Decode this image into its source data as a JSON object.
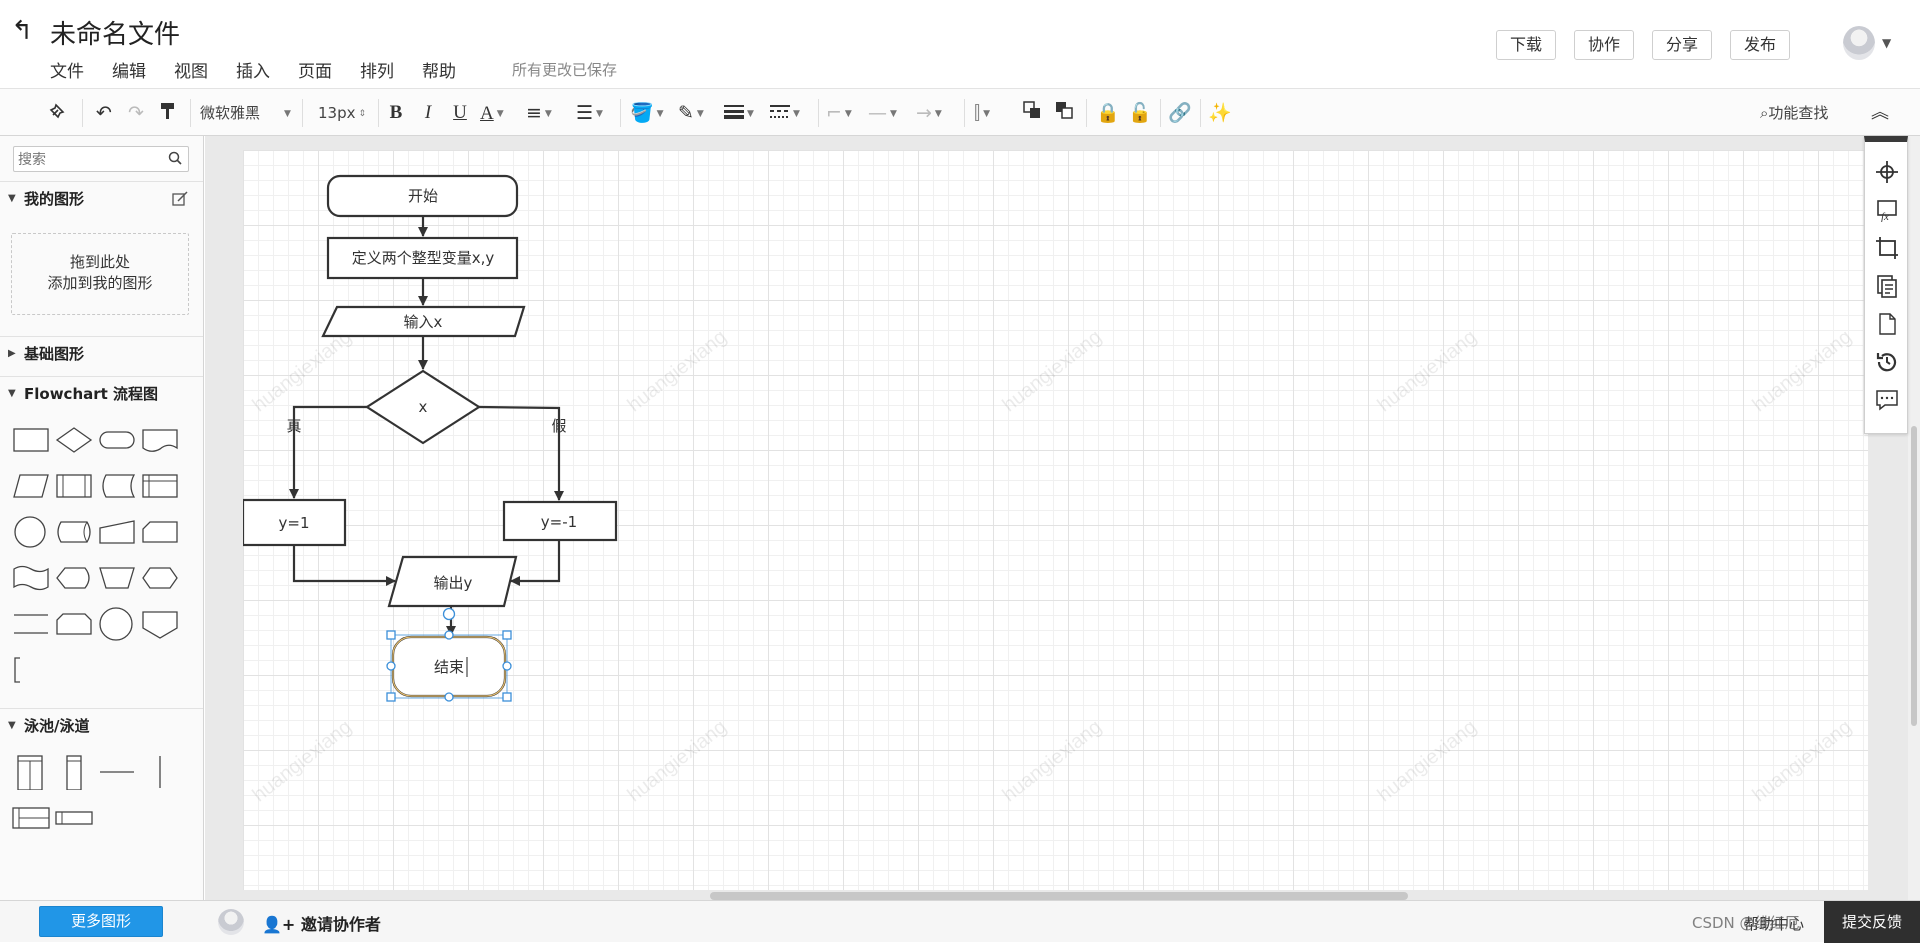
{
  "header": {
    "back_icon": "back-arrow-icon",
    "title": "未命名文件",
    "menu": [
      "文件",
      "编辑",
      "视图",
      "插入",
      "页面",
      "排列",
      "帮助"
    ],
    "save_status": "所有更改已保存",
    "actions": [
      "下载",
      "协作",
      "分享",
      "发布"
    ],
    "avatar_caret": "▼"
  },
  "toolbar": {
    "font_family": "微软雅黑",
    "font_size": "13px",
    "bold": "B",
    "italic": "I",
    "underline": "U",
    "font_color": "A",
    "feature_search": "功能查找"
  },
  "left_panel": {
    "search_placeholder": "搜索",
    "my_shapes": {
      "title": "我的图形",
      "drop_line1": "拖到此处",
      "drop_line2": "添加到我的图形"
    },
    "basic_shapes": {
      "title": "基础图形"
    },
    "flowchart": {
      "title": "Flowchart 流程图"
    },
    "swimlane": {
      "title": "泳池/泳道"
    },
    "more_shapes": "更多图形"
  },
  "diagram": {
    "nodes": {
      "start": "开始",
      "define": "定义两个整型变量x,y",
      "input": "输入x",
      "decision": "x",
      "true_label": "真",
      "false_label": "假",
      "y_pos": "y=1",
      "y_neg": "y=-1",
      "output": "输出y",
      "end": "结束"
    },
    "selected_node": "end",
    "watermark": "huangiexiang"
  },
  "bottom_bar": {
    "invite": "邀请协作者",
    "help": "帮助中心",
    "feedback": "提交反馈",
    "csdn_mark": "CSDN @绯红厄"
  },
  "colors": {
    "primary_button": "#2196e7",
    "selection": "#3b8fd9",
    "end_node_border": "#e8c070",
    "feedback_bg": "#2f2f2f"
  }
}
